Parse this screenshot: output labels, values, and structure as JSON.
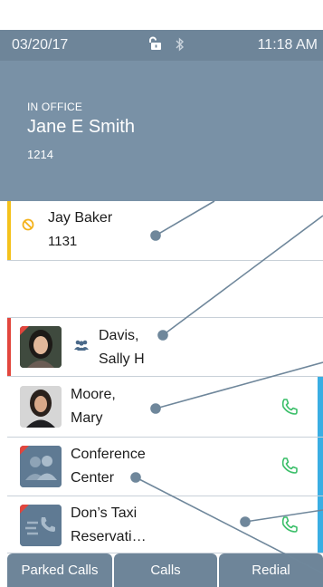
{
  "status_bar": {
    "date": "03/20/17",
    "time": "11:18 AM",
    "lock_icon": "unlock-icon",
    "bluetooth_icon": "bluetooth-icon"
  },
  "header": {
    "presence": "IN OFFICE",
    "name": "Jane E Smith",
    "extension": "1214"
  },
  "lines": [
    {
      "name": "Jay Baker",
      "detail": "1131",
      "status_icon": "do-not-disturb-icon",
      "marker_color": "#f4c21b"
    },
    {
      "name": "",
      "detail": ""
    },
    {
      "name_line1": "Davis,",
      "name_line2": "Sally H",
      "status_icon": "group-icon",
      "marker_color": "#e2463d"
    },
    {
      "name_line1": "Moore,",
      "name_line2": "Mary",
      "call_icon": "phone-icon"
    },
    {
      "name_line1": "Conference",
      "name_line2": "Center",
      "call_icon": "phone-icon"
    },
    {
      "name_line1": "Don’s Taxi",
      "name_line2": "Reservati…",
      "call_icon": "phone-icon"
    }
  ],
  "tabs": {
    "parked": "Parked Calls",
    "calls": "Calls",
    "redial": "Redial"
  },
  "colors": {
    "status_bar": "#6e8599",
    "header": "#7991a6",
    "accent_blue": "#3aaee3",
    "call_green": "#3cbf6a",
    "callout_line": "#6f879b"
  }
}
